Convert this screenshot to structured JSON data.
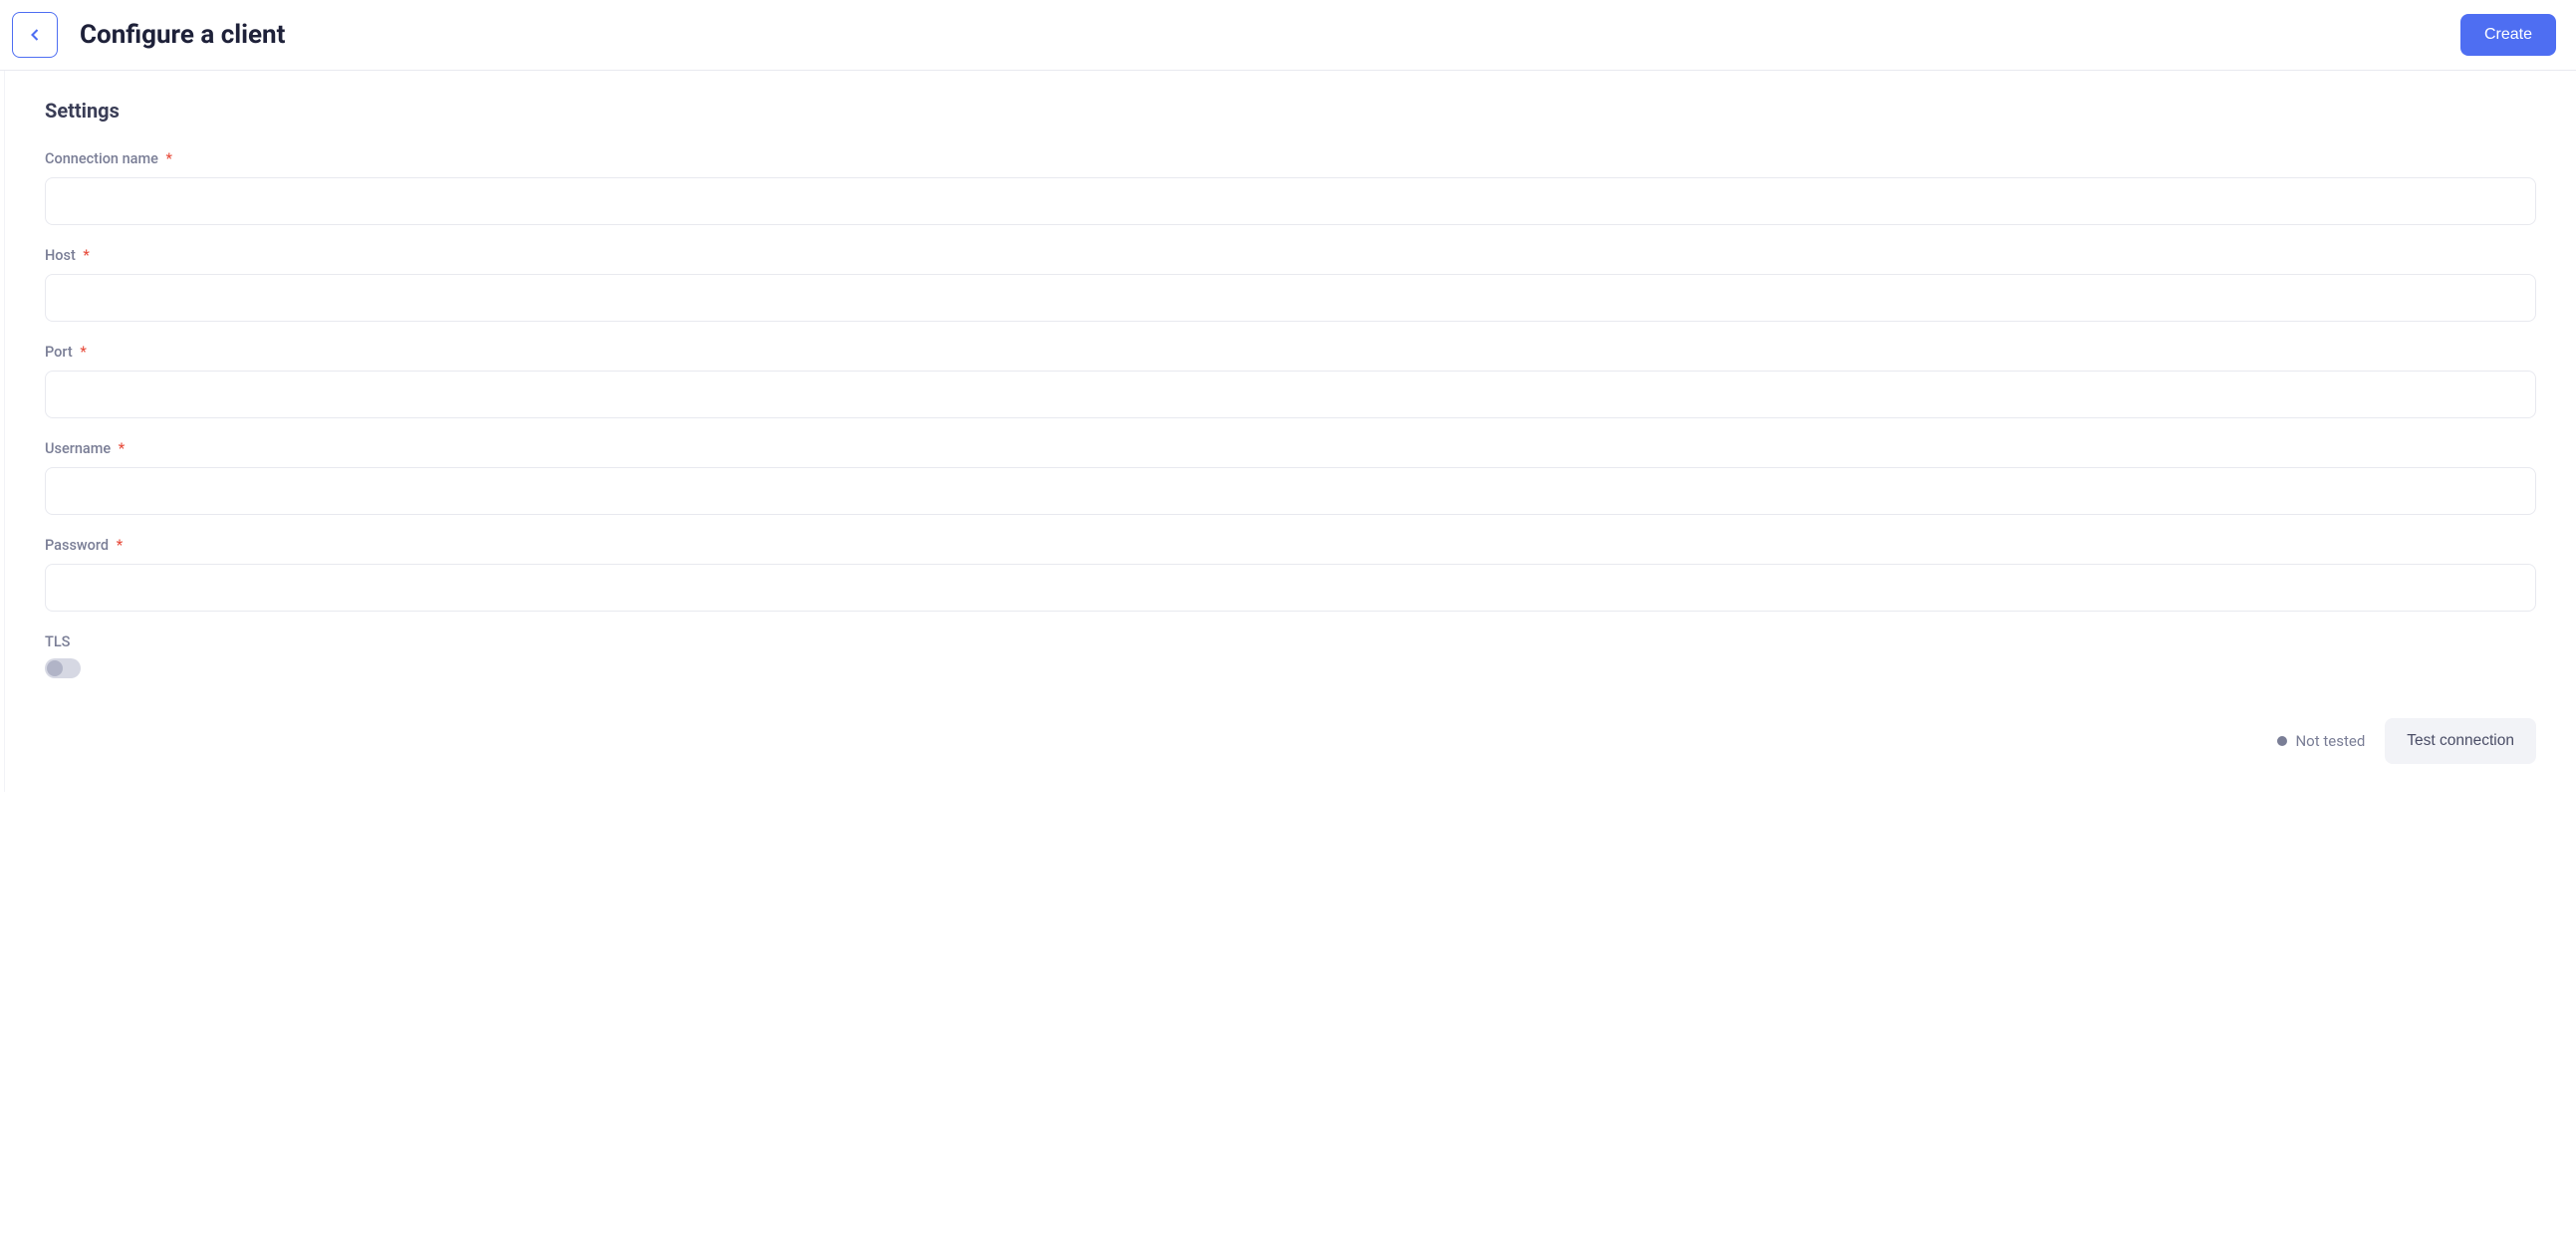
{
  "header": {
    "title": "Configure a client",
    "create_label": "Create"
  },
  "settings": {
    "section_title": "Settings",
    "fields": {
      "connection_name": {
        "label": "Connection name",
        "required": true,
        "value": ""
      },
      "host": {
        "label": "Host",
        "required": true,
        "value": ""
      },
      "port": {
        "label": "Port",
        "required": true,
        "value": ""
      },
      "username": {
        "label": "Username",
        "required": true,
        "value": ""
      },
      "password": {
        "label": "Password",
        "required": true,
        "value": ""
      },
      "tls": {
        "label": "TLS",
        "enabled": false
      }
    }
  },
  "footer": {
    "status_text": "Not tested",
    "test_button_label": "Test connection"
  }
}
